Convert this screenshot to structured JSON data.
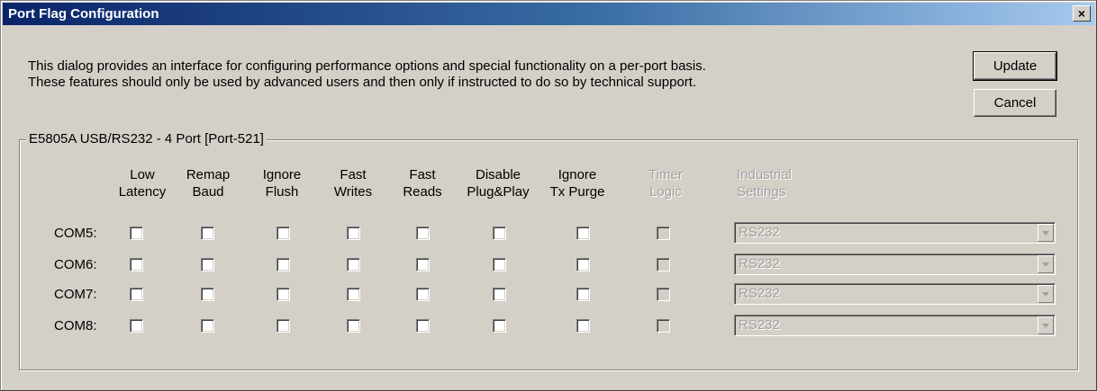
{
  "window": {
    "title": "Port Flag Configuration",
    "close_label": "×"
  },
  "description": {
    "line1": "This dialog provides an interface for configuring performance options and special functionality on a per-port basis.",
    "line2": "These features should only be used by advanced users and then only if instructed to do so by technical support."
  },
  "buttons": {
    "update": "Update",
    "cancel": "Cancel"
  },
  "group": {
    "label": "E5805A USB/RS232 - 4 Port [Port-521]"
  },
  "columns": [
    {
      "l1": "Low",
      "l2": "Latency",
      "enabled": true
    },
    {
      "l1": "Remap",
      "l2": "Baud",
      "enabled": true
    },
    {
      "l1": "Ignore",
      "l2": "Flush",
      "enabled": true
    },
    {
      "l1": "Fast",
      "l2": "Writes",
      "enabled": true
    },
    {
      "l1": "Fast",
      "l2": "Reads",
      "enabled": true
    },
    {
      "l1": "Disable",
      "l2": "Plug&Play",
      "enabled": true
    },
    {
      "l1": "Ignore",
      "l2": "Tx Purge",
      "enabled": true
    },
    {
      "l1": "Timer",
      "l2": "Logic",
      "enabled": false
    }
  ],
  "industrial": {
    "l1": "Industrial",
    "l2": "Settings",
    "enabled": false
  },
  "rows": [
    {
      "port": "COM5:",
      "checked": [
        false,
        false,
        false,
        false,
        false,
        false,
        false,
        false
      ],
      "setting": "RS232"
    },
    {
      "port": "COM6:",
      "checked": [
        false,
        false,
        false,
        false,
        false,
        false,
        false,
        false
      ],
      "setting": "RS232"
    },
    {
      "port": "COM7:",
      "checked": [
        false,
        false,
        false,
        false,
        false,
        false,
        false,
        false
      ],
      "setting": "RS232"
    },
    {
      "port": "COM8:",
      "checked": [
        false,
        false,
        false,
        false,
        false,
        false,
        false,
        false
      ],
      "setting": "RS232"
    }
  ],
  "colors": {
    "title_start": "#0a246a",
    "title_end": "#a6caf0",
    "face": "#d4d0c8",
    "disabled_text": "#a0a0a0"
  }
}
